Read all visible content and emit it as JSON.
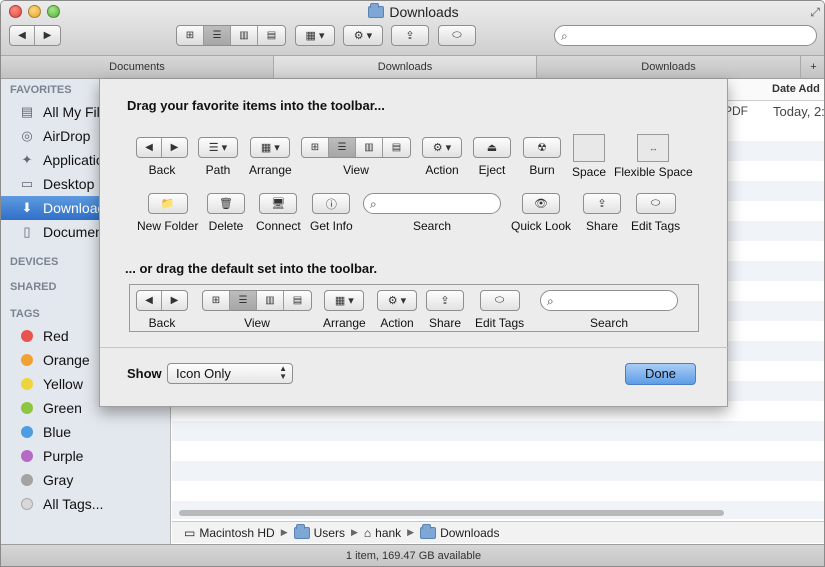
{
  "window": {
    "title": "Downloads"
  },
  "toolbar_glyphs": {
    "back": "◀",
    "forward": "▶",
    "view_icon": "⊞",
    "view_list": "☰",
    "view_column": "▥",
    "view_cover": "▤",
    "arrange": "▦ ▾",
    "action": "⚙ ▾",
    "share": "⇪",
    "tags": "⬭",
    "search": "⌕",
    "path": "☰ ▾",
    "eject": "⏏",
    "burn": "☢",
    "new_folder": "📁",
    "delete": "🗑",
    "connect": "🖥",
    "get_info": "ⓘ",
    "quick_look": "👁",
    "flexible": "↔"
  },
  "tabs": [
    "Documents",
    "Downloads",
    "Downloads"
  ],
  "sidebar": {
    "favorites_header": "FAVORITES",
    "favorites": [
      {
        "label": "All My Files",
        "icon": "all-files-icon",
        "glyph": "▤"
      },
      {
        "label": "AirDrop",
        "icon": "airdrop-icon",
        "glyph": "◎"
      },
      {
        "label": "Applications",
        "icon": "applications-icon",
        "glyph": "✦"
      },
      {
        "label": "Desktop",
        "icon": "desktop-icon",
        "glyph": "▭"
      },
      {
        "label": "Downloads",
        "icon": "downloads-icon",
        "glyph": "⬇"
      },
      {
        "label": "Documents",
        "icon": "documents-icon",
        "glyph": "▯"
      }
    ],
    "devices_header": "DEVICES",
    "shared_header": "SHARED",
    "tags_header": "TAGS",
    "tags": [
      {
        "label": "Red",
        "color": "#e9534f"
      },
      {
        "label": "Orange",
        "color": "#f0a134"
      },
      {
        "label": "Yellow",
        "color": "#efd43b"
      },
      {
        "label": "Green",
        "color": "#8fc63f"
      },
      {
        "label": "Blue",
        "color": "#4d9de0"
      },
      {
        "label": "Purple",
        "color": "#b56ac5"
      },
      {
        "label": "Gray",
        "color": "#a3a3a3"
      },
      {
        "label": "All Tags...",
        "color": "#d8d8d8"
      }
    ]
  },
  "content": {
    "col_date_added": "Date Add",
    "row_kind": "PDF",
    "row_date": "Today, 2:"
  },
  "sheet": {
    "drag_header": "Drag your favorite items into the toolbar...",
    "default_header": "... or drag the default set into the toolbar.",
    "items": {
      "back": "Back",
      "path": "Path",
      "arrange": "Arrange",
      "view": "View",
      "action": "Action",
      "eject": "Eject",
      "burn": "Burn",
      "space": "Space",
      "flexible_space": "Flexible Space",
      "new_folder": "New Folder",
      "delete": "Delete",
      "connect": "Connect",
      "get_info": "Get Info",
      "search": "Search",
      "quick_look": "Quick Look",
      "share": "Share",
      "edit_tags": "Edit Tags"
    },
    "show_label": "Show",
    "show_value": "Icon Only",
    "done_label": "Done"
  },
  "pathbar": [
    "Macintosh HD",
    "Users",
    "hank",
    "Downloads"
  ],
  "status": "1 item, 169.47 GB available"
}
